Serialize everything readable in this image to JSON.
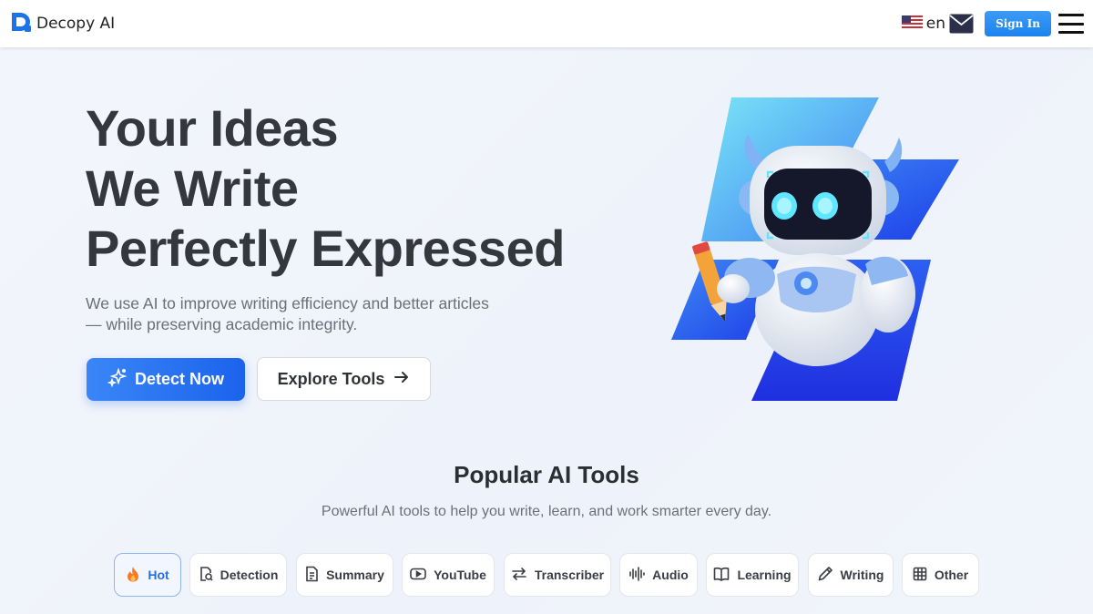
{
  "header": {
    "brand": "Decopy AI",
    "lang_code": "en",
    "signin_label": "Sign In",
    "icons": {
      "flag": "us-flag-icon",
      "mail": "mail-icon",
      "menu": "hamburger-menu-icon"
    }
  },
  "hero": {
    "title_lines": [
      "Your Ideas",
      "We Write",
      "Perfectly Expressed"
    ],
    "subtitle_line1": "We use AI to improve writing efficiency and better articles",
    "subtitle_line2": "— while preserving academic integrity.",
    "detect_label": "Detect Now",
    "explore_label": "Explore Tools",
    "illustration": "robot-with-pencil-illustration"
  },
  "tools": {
    "title": "Popular AI Tools",
    "subtitle": "Powerful AI tools to help you write, learn, and work smarter every day.",
    "tabs": [
      {
        "label": "Hot",
        "icon": "flame-icon",
        "active": true
      },
      {
        "label": "Detection",
        "icon": "document-search-icon"
      },
      {
        "label": "Summary",
        "icon": "document-icon"
      },
      {
        "label": "YouTube",
        "icon": "play-icon"
      },
      {
        "label": "Transcriber",
        "icon": "swap-arrows-icon"
      },
      {
        "label": "Audio",
        "icon": "audio-wave-icon"
      },
      {
        "label": "Learning",
        "icon": "book-icon"
      },
      {
        "label": "Writing",
        "icon": "pencil-icon"
      },
      {
        "label": "Other",
        "icon": "grid-icon"
      }
    ]
  },
  "colors": {
    "accent": "#1f6cee",
    "signin": "#2a8ff2",
    "text": "#34373b"
  }
}
